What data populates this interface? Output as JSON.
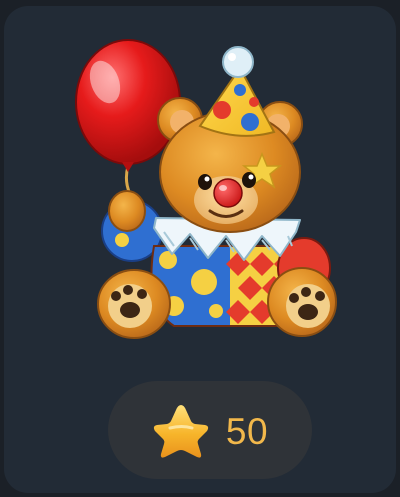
{
  "gift": {
    "icon": "clown-teddy-bear-with-balloon",
    "price": "50",
    "currency_icon": "gold-star-icon"
  },
  "colors": {
    "background": "#1b2027",
    "card": "#222b36",
    "pill": "#2f3338",
    "price_text": "#f2b84b"
  }
}
